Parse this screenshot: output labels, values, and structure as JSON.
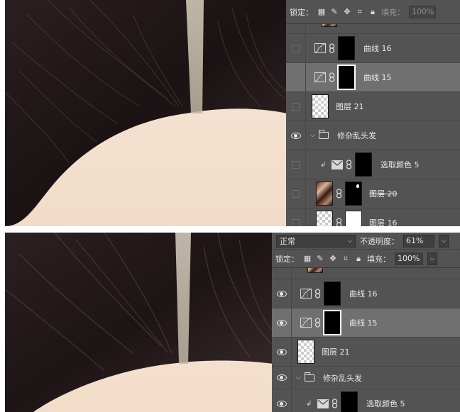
{
  "top_panel": {
    "lock_label": "锁定：",
    "fill_label": "填充：",
    "fill_value": "100%",
    "layers": [
      {
        "name": "曲线 16",
        "type": "curves",
        "visible": false,
        "selected": false
      },
      {
        "name": "曲线 15",
        "type": "curves",
        "visible": false,
        "selected": true
      },
      {
        "name": "图层 21",
        "type": "pixel",
        "visible": false,
        "selected": false
      },
      {
        "name": "修杂乱头发",
        "type": "group",
        "visible": true,
        "selected": false
      },
      {
        "name": "选取颜色 5",
        "type": "selective-color",
        "visible": false,
        "selected": false
      },
      {
        "name": "图层 20",
        "type": "pixel-masked",
        "visible": false,
        "selected": false
      },
      {
        "name": "图层 16",
        "type": "pixel-masked",
        "visible": false,
        "selected": false
      }
    ]
  },
  "bottom_panel": {
    "blend_mode": "正常",
    "opacity_label": "不透明度：",
    "opacity_value": "61%",
    "lock_label": "锁定：",
    "fill_label": "填充：",
    "fill_value": "100%",
    "layers": [
      {
        "name": "曲线 16",
        "type": "curves",
        "visible": true,
        "selected": false
      },
      {
        "name": "曲线 15",
        "type": "curves",
        "visible": true,
        "selected": true
      },
      {
        "name": "图层 21",
        "type": "pixel",
        "visible": true,
        "selected": false
      },
      {
        "name": "修杂乱头发",
        "type": "group",
        "visible": true,
        "selected": false
      },
      {
        "name": "选取颜色 5",
        "type": "selective-color",
        "visible": true,
        "selected": false
      }
    ]
  },
  "colors": {
    "panel_bg": "#535353",
    "selected_row": "#707070",
    "hair_dark": "#1c1314",
    "skin": "#f5e4d4"
  }
}
